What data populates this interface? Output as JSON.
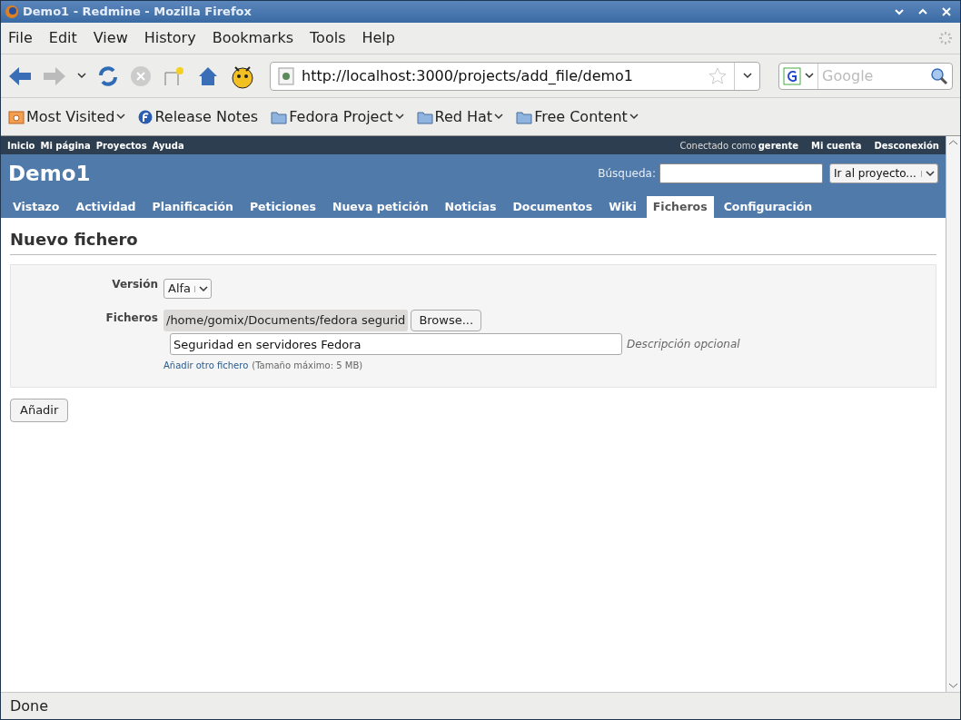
{
  "window": {
    "title": "Demo1 - Redmine - Mozilla Firefox"
  },
  "menu": [
    "File",
    "Edit",
    "View",
    "History",
    "Bookmarks",
    "Tools",
    "Help"
  ],
  "address": {
    "value": "http://localhost:3000/projects/add_file/demo1"
  },
  "search": {
    "placeholder": "Google"
  },
  "bookmarks": [
    {
      "kind": "smart",
      "label": "Most Visited",
      "dropdown": true
    },
    {
      "kind": "fedora",
      "label": "Release Notes",
      "dropdown": false
    },
    {
      "kind": "folder",
      "label": "Fedora Project",
      "dropdown": true
    },
    {
      "kind": "folder",
      "label": "Red Hat",
      "dropdown": true
    },
    {
      "kind": "folder",
      "label": "Free Content",
      "dropdown": true
    }
  ],
  "top_menu": {
    "left": [
      "Inicio",
      "Mi página",
      "Proyectos",
      "Ayuda"
    ],
    "logged_as": "Conectado como",
    "user": "gerente",
    "right": [
      "Mi cuenta",
      "Desconexión"
    ]
  },
  "header": {
    "title": "Demo1",
    "search_label": "Búsqueda:",
    "jump": "Ir al proyecto..."
  },
  "tabs": [
    {
      "label": "Vistazo",
      "selected": false
    },
    {
      "label": "Actividad",
      "selected": false
    },
    {
      "label": "Planificación",
      "selected": false
    },
    {
      "label": "Peticiones",
      "selected": false
    },
    {
      "label": "Nueva petición",
      "selected": false
    },
    {
      "label": "Noticias",
      "selected": false
    },
    {
      "label": "Documentos",
      "selected": false
    },
    {
      "label": "Wiki",
      "selected": false
    },
    {
      "label": "Ficheros",
      "selected": true
    },
    {
      "label": "Configuración",
      "selected": false
    }
  ],
  "content": {
    "heading": "Nuevo fichero",
    "version_label": "Versión",
    "version": "Alfa",
    "files_label": "Ficheros",
    "file_path": "/home/gomix/Documents/fedora segurid",
    "browse": "Browse...",
    "description": "Seguridad en servidores Fedora",
    "description_hint": "Descripción opcional",
    "add_link": "Añadir otro fichero",
    "max_size": "(Tamaño máximo: 5 MB)",
    "submit": "Añadir"
  },
  "status_bar": "Done"
}
